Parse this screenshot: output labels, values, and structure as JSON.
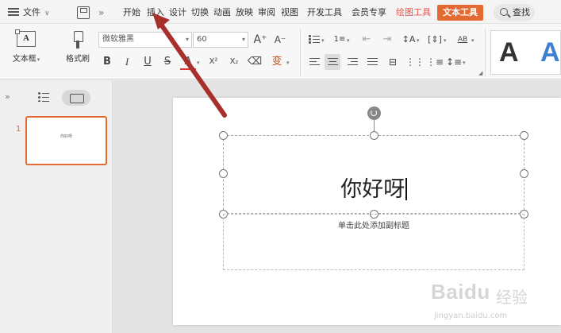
{
  "menubar": {
    "file_label": "文件",
    "tabs": [
      {
        "label": "开始",
        "style": "normal"
      },
      {
        "label": "插入",
        "style": "normal"
      },
      {
        "label": "设计",
        "style": "normal"
      },
      {
        "label": "切换",
        "style": "normal"
      },
      {
        "label": "动画",
        "style": "normal"
      },
      {
        "label": "放映",
        "style": "normal"
      },
      {
        "label": "审阅",
        "style": "normal"
      },
      {
        "label": "视图",
        "style": "normal"
      },
      {
        "label": "开发工具",
        "style": "normal"
      },
      {
        "label": "会员专享",
        "style": "normal"
      },
      {
        "label": "绘图工具",
        "style": "accent"
      },
      {
        "label": "文本工具",
        "style": "active"
      }
    ],
    "search_label": "查找",
    "active_tab_color": "#e46a34",
    "accent_tab_color": "#e8554e"
  },
  "ribbon": {
    "textbox_label": "文本框",
    "format_painter_label": "格式刷",
    "font_family": "微软雅黑",
    "font_size": "60",
    "bold_glyph": "B",
    "italic_glyph": "I",
    "underline_glyph": "U",
    "strike_glyph": "S",
    "fontcolor_glyph": "A",
    "superscript_glyph": "X²",
    "subscript_glyph": "X₂",
    "phonetic_glyph": "变",
    "grow_font_glyph": "A⁺",
    "shrink_font_glyph": "A⁻",
    "style_samples": [
      {
        "glyph": "A",
        "color": "#111111"
      },
      {
        "glyph": "A",
        "color": "#3e7fce"
      }
    ]
  },
  "left_pane": {
    "slide_number": "1",
    "thumb_text": "你好呀",
    "selected_color": "#e46a34"
  },
  "slide": {
    "title": "你好呀",
    "subtitle_placeholder": "单击此处添加副标题"
  },
  "watermark": {
    "brand": "Baidu",
    "sub": "经验",
    "url": "jingyan.baidu.com"
  },
  "annotation": {
    "arrow_color": "#a8302c",
    "points_to": "插入"
  }
}
